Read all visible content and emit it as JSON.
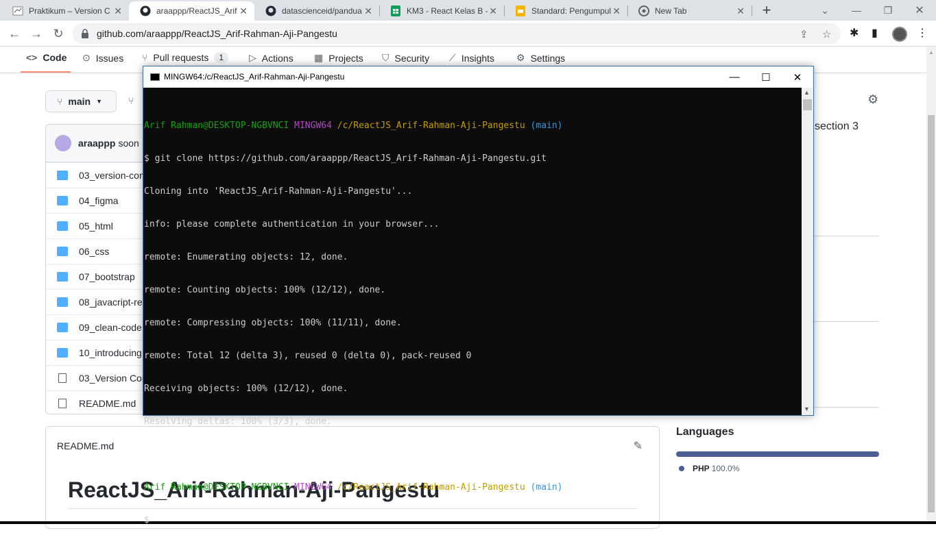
{
  "browser": {
    "tabs": [
      {
        "title": "Praktikum – Version C",
        "icon": "praktikum-icon"
      },
      {
        "title": "araappp/ReactJS_Arif-",
        "icon": "github-icon",
        "active": true
      },
      {
        "title": "datascienceid/pandua",
        "icon": "github-icon"
      },
      {
        "title": "KM3 - React Kelas B -",
        "icon": "sheets-icon"
      },
      {
        "title": "Standard: Pengumpul",
        "icon": "slides-icon"
      },
      {
        "title": "New Tab",
        "icon": "chrome-icon"
      }
    ],
    "url": "github.com/araappp/ReactJS_Arif-Rahman-Aji-Pangestu",
    "new_tab": "+"
  },
  "repo_nav": {
    "items": [
      {
        "label": "Code",
        "icon": "code-icon"
      },
      {
        "label": "Issues",
        "icon": "issue-icon"
      },
      {
        "label": "Pull requests",
        "icon": "pull-request-icon",
        "count": "1"
      },
      {
        "label": "Actions",
        "icon": "play-icon"
      },
      {
        "label": "Projects",
        "icon": "table-icon"
      },
      {
        "label": "Security",
        "icon": "shield-icon"
      },
      {
        "label": "Insights",
        "icon": "graph-icon"
      },
      {
        "label": "Settings",
        "icon": "gear-icon"
      }
    ]
  },
  "repo": {
    "branch": "main",
    "commit_author": "araappp",
    "commit_snippet": "soon",
    "files": [
      {
        "name": "03_version-con",
        "type": "folder"
      },
      {
        "name": "04_figma",
        "type": "folder"
      },
      {
        "name": "05_html",
        "type": "folder"
      },
      {
        "name": "06_css",
        "type": "folder"
      },
      {
        "name": "07_bootstrap",
        "type": "folder"
      },
      {
        "name": "08_javacript-ref",
        "type": "folder"
      },
      {
        "name": "09_clean-code",
        "type": "folder"
      },
      {
        "name": "10_introducing",
        "type": "folder"
      },
      {
        "name": "03_Version Con",
        "type": "file"
      },
      {
        "name": "README.md",
        "type": "file"
      }
    ],
    "about_fragment": "section 3"
  },
  "languages": {
    "title": "Languages",
    "items": [
      {
        "name": "PHP",
        "percent": "100.0%",
        "color": "#4f5d95"
      }
    ]
  },
  "readme": {
    "filename": "README.md",
    "heading": "ReactJS_Arif-Rahman-Aji-Pangestu"
  },
  "terminal": {
    "title": "MINGW64:/c/ReactJS_Arif-Rahman-Aji-Pangestu",
    "prompt1": {
      "user": "Arif Rahman@DESKTOP-NGBVNCI",
      "shell": "MINGW64",
      "path": "/c/ReactJS_Arif-Rahman-Aji-Pangestu",
      "branch": "(main)"
    },
    "command": "$ git clone https://github.com/araappp/ReactJS_Arif-Rahman-Aji-Pangestu.git",
    "output": [
      "Cloning into 'ReactJS_Arif-Rahman-Aji-Pangestu'...",
      "info: please complete authentication in your browser...",
      "remote: Enumerating objects: 12, done.",
      "remote: Counting objects: 100% (12/12), done.",
      "remote: Compressing objects: 100% (11/11), done.",
      "remote: Total 12 (delta 3), reused 0 (delta 0), pack-reused 0",
      "Receiving objects: 100% (12/12), done.",
      "Resolving deltas: 100% (3/3), done."
    ],
    "prompt2": {
      "user": "Arif Rahman@DESKTOP-NGBVNCI",
      "shell": "MINGW64",
      "path": "/c/ReactJS_Arif-Rahman-Aji-Pangestu",
      "branch": "(main)"
    },
    "cursor_line": "$"
  }
}
